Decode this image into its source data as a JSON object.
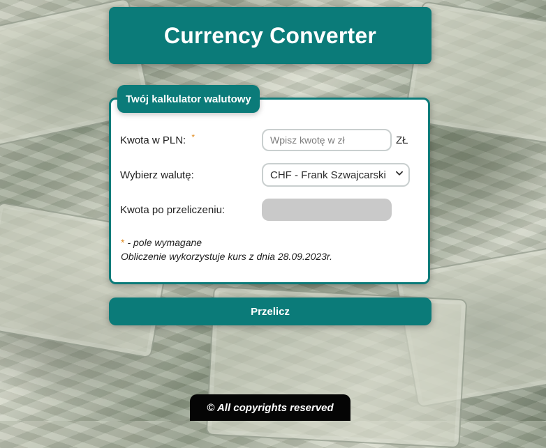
{
  "app": {
    "title": "Currency Converter"
  },
  "calculator": {
    "tab_label": "Twój kalkulator walutowy",
    "amount_label": "Kwota w PLN:",
    "required_marker": "*",
    "amount_placeholder": "Wpisz kwotę w zł",
    "amount_value": "",
    "amount_unit": "ZŁ",
    "currency_label": "Wybierz walutę:",
    "selected_currency": "CHF - Frank Szwajcarski",
    "result_label": "Kwota po przeliczeniu:",
    "result_value": "",
    "required_note": "- pole wymagane",
    "rate_note": "Obliczenie wykorzystuje kurs z dnia 28.09.2023r."
  },
  "actions": {
    "convert_label": "Przelicz"
  },
  "footer": {
    "copyright": "© All copyrights reserved"
  },
  "colors": {
    "accent": "#0b7b79",
    "required": "#e08a1e"
  },
  "icons": {
    "dropdown": "chevron-down-icon"
  }
}
